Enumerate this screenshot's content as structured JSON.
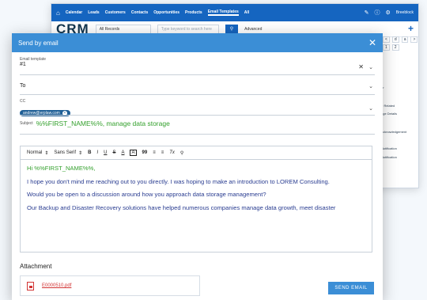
{
  "background_app": {
    "nav_tabs": [
      "Calendar",
      "Leads",
      "Customers",
      "Contacts",
      "Opportunities",
      "Products",
      "Email Templates",
      "All"
    ],
    "active_tab": "Email Templates",
    "user": "Breeblock",
    "logo": "CRM",
    "record_select": "All Records",
    "search_placeholder": "Type keyword to search here",
    "advanced_label": "Advanced",
    "right_panel_items": [
      "er",
      "> Related",
      "age Details",
      "acknowledgement",
      "Notification",
      "Notification"
    ],
    "pager": [
      "<",
      "d",
      "a",
      ">"
    ],
    "pager2": [
      "1",
      "2"
    ]
  },
  "modal": {
    "title": "Send by email",
    "email_template": {
      "label": "Email template",
      "value": "#1"
    },
    "to": {
      "label": "To"
    },
    "cc": {
      "label": "CC",
      "chip": "andrew@erplaw.com"
    },
    "subject": {
      "label": "Subject",
      "value": "%%FIRST_NAME%%, manage data storage"
    },
    "toolbar": {
      "format": "Normal",
      "font": "Sans Serif",
      "bold": "B",
      "italic": "I",
      "underline": "U",
      "strike": "S",
      "color": "A",
      "bg": "A",
      "quote": "99",
      "ol": "≡",
      "ul": "≡",
      "clear": "Tx",
      "link": "⚲"
    },
    "body": [
      "Hi %%FIRST_NAME%%,",
      "I hope you don't mind me reaching out to you directly. I was hoping to make an  introduction to LOREM Consulting.",
      "Would you be open to a discussion around how you approach data storage management?",
      "Our Backup and Disaster Recovery solutions have helped numerous companies  manage data growth, meet disaster"
    ],
    "attachment": {
      "title": "Attachment",
      "file": "E0000510.pdf"
    },
    "send_label": "SEND EMAIL"
  },
  "colors": {
    "primary": "#3b8ed6",
    "nav": "#1565c0",
    "body_text": "#2a3d91",
    "variable": "#33a02c",
    "pdf": "#d23434"
  }
}
